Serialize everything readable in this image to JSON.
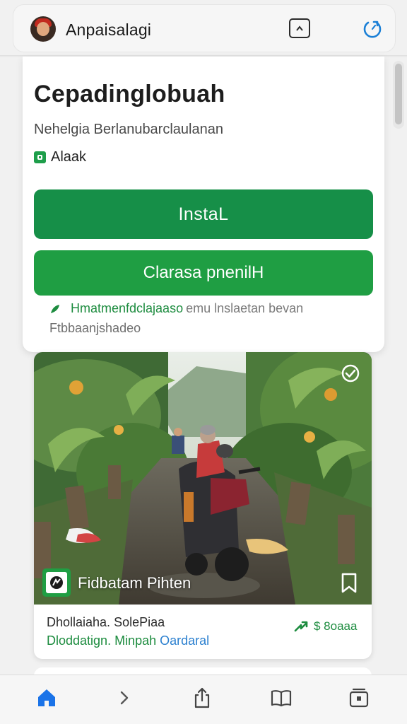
{
  "topbar": {
    "app_name": "Anpaisalagi",
    "avatar": "app-avatar-icon",
    "share_icon": "share-box-icon",
    "refresh_icon": "refresh-icon"
  },
  "app_card": {
    "title": "Cepadinglobuah",
    "subtitle": "Nehelgia Berlanubarclaulanan",
    "rating_icon": "rating-badge-icon",
    "rating_label": "Alaak",
    "install_label": "InstaL",
    "secondary_label": "Clarasa pnenilH",
    "note_green": "Hmatmenfdclajaaso",
    "note_gray": "emu lnslaetan bevan",
    "note_line2": "Ftbbaanjshadeo"
  },
  "media": {
    "video_title": "Fidbatam Pihten",
    "caption_line1": "Dhollaiaha. SolePiaa",
    "caption_line2_green": "Dloddatign. Minpah",
    "caption_line2_blue": "Oardaral",
    "trend_label": "$ 8oaaa",
    "colors": {
      "accent_green": "#1f9e43",
      "link_blue": "#2a7fcf"
    }
  },
  "bottombar": {
    "items": [
      "home-icon",
      "forward-chevron-icon",
      "share-icon",
      "bookmarks-icon",
      "tabs-icon"
    ]
  },
  "colors": {
    "install_button": "#168f48",
    "secondary_button": "#1f9e43",
    "home_blue": "#1a73e8"
  }
}
